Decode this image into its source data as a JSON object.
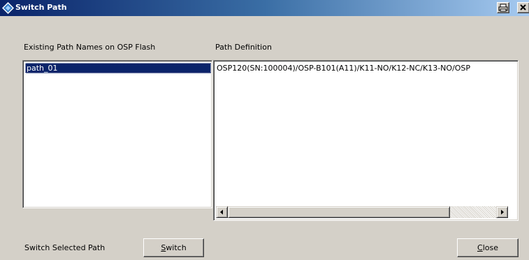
{
  "window": {
    "title": "Switch Path"
  },
  "labels": {
    "existing": "Existing Path Names on OSP Flash",
    "definition": "Path Definition",
    "switch_selected": "Switch Selected Path"
  },
  "path_list": {
    "items": [
      "path_01"
    ],
    "selected": "path_01"
  },
  "path_definition": "OSP120(SN:100004)/OSP-B101(A11)/K11-NO/K12-NC/K13-NO/OSP",
  "buttons": {
    "switch_accel": "S",
    "switch_rest": "witch",
    "close_accel": "C",
    "close_rest": "lose"
  },
  "icons": [
    "app-diamond-icon",
    "print-icon",
    "close-icon",
    "scroll-left-icon",
    "scroll-right-icon"
  ]
}
